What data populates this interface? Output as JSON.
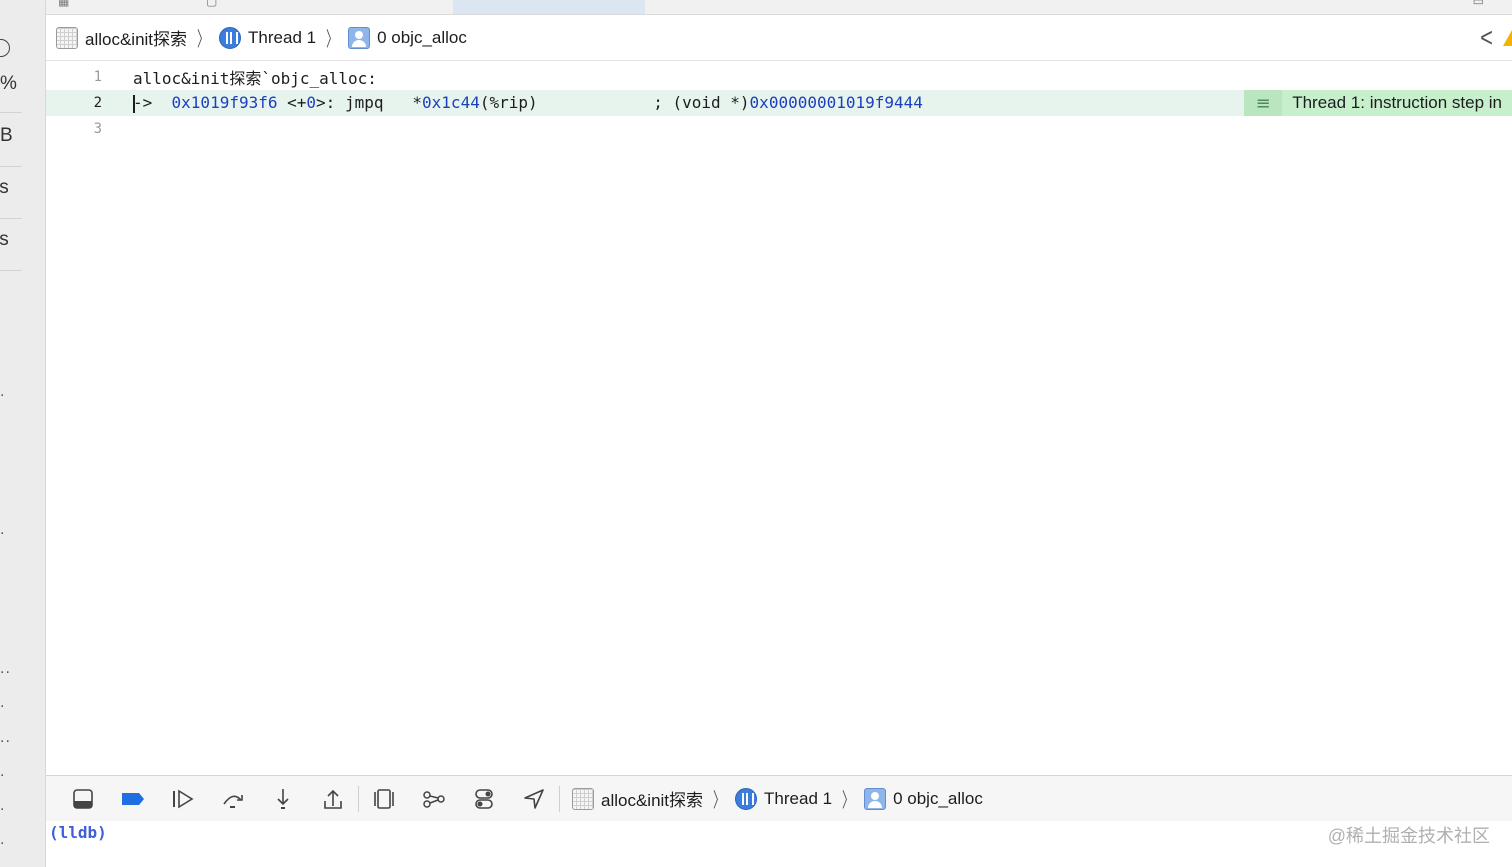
{
  "left_fragments": [
    "i",
    "%",
    "B",
    "/s",
    "/s"
  ],
  "jumpbar": {
    "project": "alloc&init探索",
    "thread": "Thread 1",
    "frame": "0 objc_alloc"
  },
  "editor": {
    "lines": [
      {
        "number": "1",
        "text": "alloc&init探索`objc_alloc:"
      },
      {
        "number": "2",
        "arrow": "->",
        "address": "0x1019f93f6",
        "offset_open": "<+",
        "offset": "0",
        "offset_close": ">: jmpq",
        "operand_star": "*",
        "operand_num": "0x1c44",
        "operand_reg": "(%rip)",
        "comment": "; (void *)",
        "comment_addr": "0x00000001019f9444"
      },
      {
        "number": "3",
        "text": ""
      }
    ],
    "annotation": "Thread 1: instruction step in"
  },
  "debugbar": {
    "icons": [
      "toggle-console-icon",
      "breakpoints-icon",
      "continue-icon",
      "step-over-icon",
      "step-into-icon",
      "step-out-icon",
      "view-hierarchy-icon",
      "memory-graph-icon",
      "environment-overrides-icon",
      "location-icon"
    ],
    "project": "alloc&init探索",
    "thread": "Thread 1",
    "frame": "0 objc_alloc"
  },
  "console": {
    "prompt": "(lldb)",
    "watermark": "@稀土掘金技术社区"
  },
  "colors": {
    "highlight_line": "#e6f4ed",
    "annotation_bg": "#c8efcc",
    "number_blue": "#1c3fbf",
    "prompt_blue": "#3e5fd6"
  }
}
